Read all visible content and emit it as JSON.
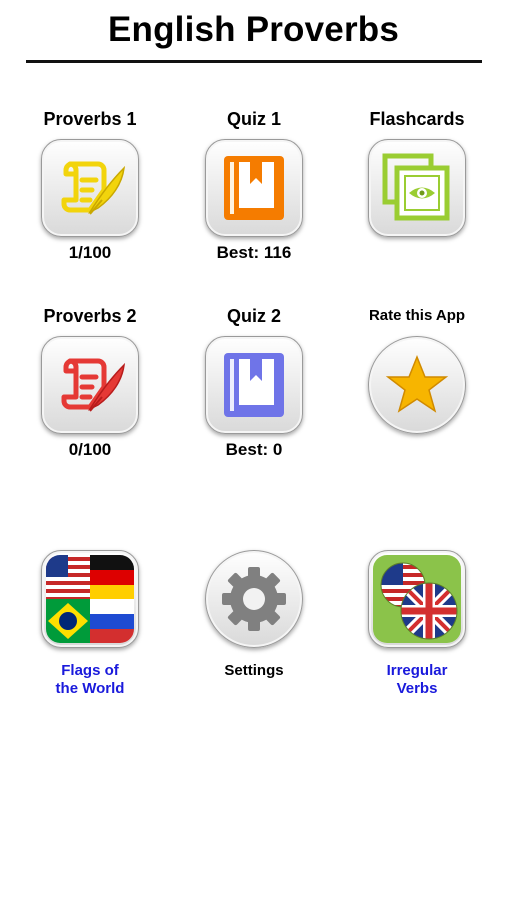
{
  "header": {
    "title": "English Proverbs"
  },
  "menu": {
    "proverbs1": {
      "label": "Proverbs 1",
      "progress": "1/100"
    },
    "quiz1": {
      "label": "Quiz 1",
      "best": "Best: 116"
    },
    "flashcards": {
      "label": "Flashcards"
    },
    "proverbs2": {
      "label": "Proverbs 2",
      "progress": "0/100"
    },
    "quiz2": {
      "label": "Quiz 2",
      "best": "Best: 0"
    },
    "rate": {
      "label": "Rate this App"
    },
    "flags": {
      "line1": "Flags of",
      "line2": "the World"
    },
    "settings": {
      "label": "Settings"
    },
    "irregular": {
      "line1": "Irregular",
      "line2": "Verbs"
    }
  },
  "colors": {
    "proverbs1_icon": "#f2d40c",
    "quiz1_icon": "#f57c00",
    "flashcards_icon": "#9acd32",
    "proverbs2_icon": "#e53935",
    "quiz2_icon": "#6f74e8",
    "star": "#f7b500",
    "link": "#1a1adc"
  },
  "icons": {
    "proverbs1": "scroll-quill-icon",
    "quiz1": "book-icon",
    "flashcards": "cards-eye-icon",
    "proverbs2": "scroll-quill-icon",
    "quiz2": "book-icon",
    "rate": "star-icon",
    "flags": "flags-icon",
    "settings": "gear-icon",
    "irregular": "uk-us-flags-icon"
  }
}
